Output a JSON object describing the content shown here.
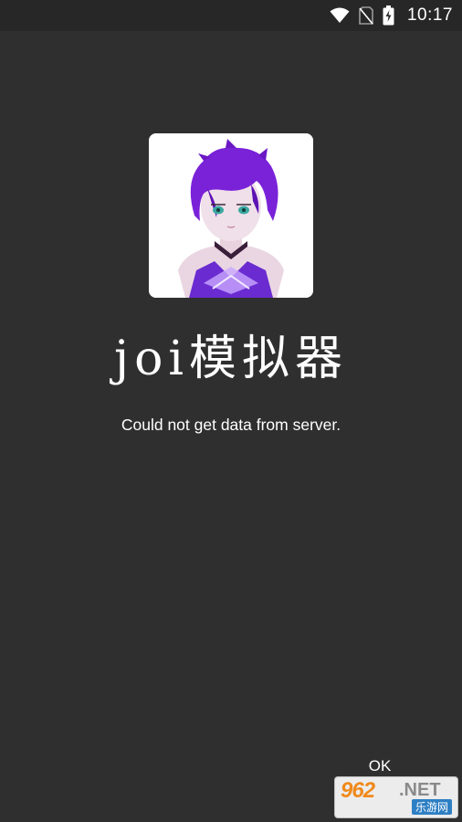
{
  "status_bar": {
    "time": "10:17",
    "icons": [
      "wifi-icon",
      "no-sim-icon",
      "battery-charging-icon"
    ]
  },
  "app": {
    "icon": "app-icon-anime-avatar",
    "title": "joi模拟器"
  },
  "dialog": {
    "message": "Could not get data from server.",
    "ok_label": "OK"
  },
  "watermark": {
    "number": "962",
    "suffix": ".NET",
    "site_name": "乐游网"
  },
  "colors": {
    "background": "#2f2f2f",
    "status_bar": "#272727",
    "text": "#ffffff",
    "hair_purple": "#7a22d8",
    "watermark_orange": "#f08a1c"
  }
}
